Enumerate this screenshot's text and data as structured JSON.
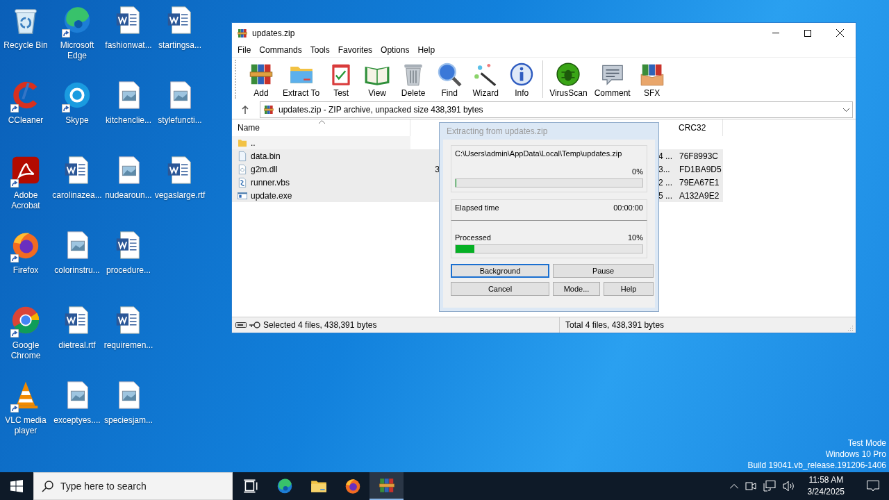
{
  "desktop": {
    "icons": [
      {
        "label": "Recycle Bin",
        "kind": "recycle",
        "shortcut": false
      },
      {
        "label": "CCleaner",
        "kind": "ccleaner",
        "shortcut": true
      },
      {
        "label": "Adobe Acrobat",
        "kind": "acrobat",
        "shortcut": true
      },
      {
        "label": "Firefox",
        "kind": "firefox",
        "shortcut": true
      },
      {
        "label": "Google Chrome",
        "kind": "chrome",
        "shortcut": true
      },
      {
        "label": "VLC media player",
        "kind": "vlc",
        "shortcut": true
      },
      {
        "label": "Microsoft Edge",
        "kind": "edge",
        "shortcut": true
      },
      {
        "label": "Skype",
        "kind": "skype",
        "shortcut": true
      },
      {
        "label": "carolinazea...",
        "kind": "word",
        "shortcut": false
      },
      {
        "label": "colorinstru...",
        "kind": "image",
        "shortcut": false
      },
      {
        "label": "dietreal.rtf",
        "kind": "word",
        "shortcut": false
      },
      {
        "label": "exceptyes....",
        "kind": "image",
        "shortcut": false
      },
      {
        "label": "fashionwat...",
        "kind": "word",
        "shortcut": false
      },
      {
        "label": "kitchenclie...",
        "kind": "image",
        "shortcut": false
      },
      {
        "label": "nudearoun...",
        "kind": "image",
        "shortcut": false
      },
      {
        "label": "procedure...",
        "kind": "word",
        "shortcut": false
      },
      {
        "label": "requiremen...",
        "kind": "word",
        "shortcut": false
      },
      {
        "label": "speciesjam...",
        "kind": "image",
        "shortcut": false
      },
      {
        "label": "startingsa...",
        "kind": "word",
        "shortcut": false
      },
      {
        "label": "stylefuncti...",
        "kind": "image",
        "shortcut": false
      },
      {
        "label": "vegaslarge.rtf",
        "kind": "word",
        "shortcut": false
      }
    ]
  },
  "window": {
    "title": "updates.zip",
    "menu": [
      "File",
      "Commands",
      "Tools",
      "Favorites",
      "Options",
      "Help"
    ],
    "toolbar": [
      {
        "label": "Add",
        "kind": "add"
      },
      {
        "label": "Extract To",
        "kind": "extract"
      },
      {
        "label": "Test",
        "kind": "test"
      },
      {
        "label": "View",
        "kind": "view"
      },
      {
        "label": "Delete",
        "kind": "delete"
      },
      {
        "label": "Find",
        "kind": "find"
      },
      {
        "label": "Wizard",
        "kind": "wizard"
      },
      {
        "label": "Info",
        "kind": "info"
      },
      {
        "label": "VirusScan",
        "kind": "virusscan",
        "separator_before": true
      },
      {
        "label": "Comment",
        "kind": "comment"
      },
      {
        "label": "SFX",
        "kind": "sfx"
      }
    ],
    "address": "updates.zip - ZIP archive, unpacked size 438,391 bytes",
    "columns": {
      "name": "Name",
      "crc": "CRC32"
    },
    "rows": [
      {
        "name": "..",
        "kind": "folder",
        "selected": false
      },
      {
        "name": "data.bin",
        "kind": "file",
        "selected": true,
        "column_3": "4 ...",
        "crc": "76F8993C"
      },
      {
        "name": "g2m.dll",
        "kind": "dll",
        "selected": true,
        "column_2": "3",
        "column_3": "3...",
        "crc": "FD1BA9D5"
      },
      {
        "name": "runner.vbs",
        "kind": "script",
        "selected": true,
        "column_3": "2 ...",
        "crc": "79EA67E1"
      },
      {
        "name": "update.exe",
        "kind": "exe",
        "selected": true,
        "column_3": "5 ...",
        "crc": "A132A9E2"
      }
    ],
    "status_left": "Selected 4 files, 438,391 bytes",
    "status_right": "Total 4 files, 438,391 bytes"
  },
  "dialog": {
    "title": "Extracting from updates.zip",
    "path": "C:\\Users\\admin\\AppData\\Local\\Temp\\updates.zip",
    "percent": "0%",
    "progress": {
      "level": 0
    },
    "elapsed_label": "Elapsed time",
    "elapsed": "00:00:00",
    "processed_label": "Processed",
    "processed_percent": "10%",
    "processed": {
      "level": 0.1
    },
    "buttons": [
      {
        "label": "Background",
        "focused": true
      },
      {
        "label": "Pause",
        "focused": false
      },
      {
        "label": "Cancel",
        "focused": false
      },
      {
        "label": "Mode...",
        "focused": false
      },
      {
        "label": "Help",
        "focused": false
      }
    ]
  },
  "system_text": [
    "Test Mode",
    "Windows 10 Pro",
    "Build 19041.vb_release.191206-1406"
  ],
  "taskbar": {
    "search_placeholder": "Type here to search",
    "apps": [
      {
        "kind": "taskview",
        "active": false
      },
      {
        "kind": "edge",
        "active": false
      },
      {
        "kind": "explorer",
        "active": false
      },
      {
        "kind": "firefox",
        "active": false
      },
      {
        "kind": "winrar",
        "active": true
      }
    ],
    "time": "11:58 AM",
    "date": "3/24/2025"
  }
}
